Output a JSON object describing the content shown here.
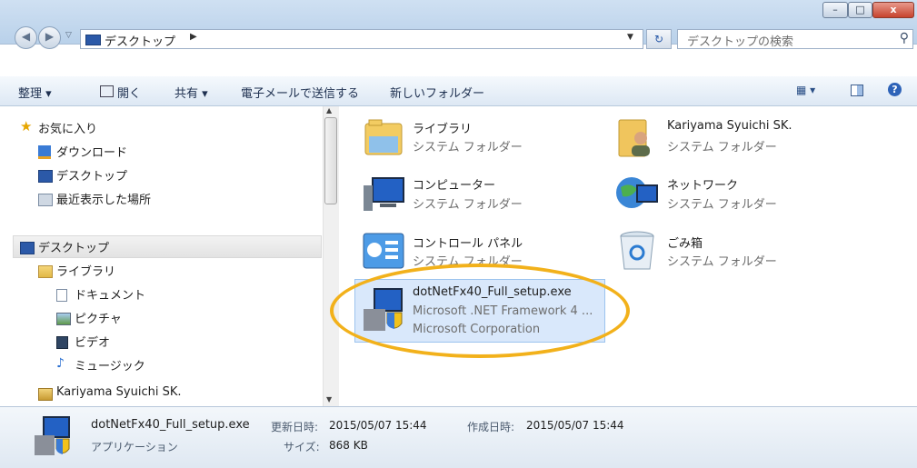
{
  "address": {
    "location": "デスクトップ",
    "search_placeholder": "デスクトップの検索"
  },
  "window": {
    "minimize": "–",
    "maximize": "□",
    "close": "x"
  },
  "toolbar": {
    "organize": "整理 ▾",
    "open": "開く",
    "share": "共有 ▾",
    "email": "電子メールで送信する",
    "new_folder": "新しいフォルダー"
  },
  "nav": {
    "favorites": "お気に入り",
    "downloads": "ダウンロード",
    "desktop_fav": "デスクトップ",
    "recent": "最近表示した場所",
    "desktop": "デスクトップ",
    "libraries": "ライブラリ",
    "documents": "ドキュメント",
    "pictures": "ピクチャ",
    "videos": "ビデオ",
    "music": "ミュージック",
    "user": "Kariyama Syuichi SK."
  },
  "items": [
    {
      "name": "ライブラリ",
      "sub": "システム フォルダー",
      "icon": "library-folder-icon"
    },
    {
      "name": "Kariyama Syuichi SK.",
      "sub": "システム フォルダー",
      "icon": "user-folder-icon"
    },
    {
      "name": "コンピューター",
      "sub": "システム フォルダー",
      "icon": "computer-icon"
    },
    {
      "name": "ネットワーク",
      "sub": "システム フォルダー",
      "icon": "network-icon"
    },
    {
      "name": "コントロール パネル",
      "sub": "システム フォルダー",
      "icon": "control-panel-icon"
    },
    {
      "name": "ごみ箱",
      "sub": "システム フォルダー",
      "icon": "recycle-bin-icon"
    }
  ],
  "selected_file": {
    "name": "dotNetFx40_Full_setup.exe",
    "description": "Microsoft .NET Framework 4 ...",
    "company": "Microsoft Corporation"
  },
  "details": {
    "filename": "dotNetFx40_Full_setup.exe",
    "modified_label": "更新日時:",
    "modified_value": "2015/05/07 15:44",
    "created_label": "作成日時:",
    "created_value": "2015/05/07 15:44",
    "type": "アプリケーション",
    "size_label": "サイズ:",
    "size_value": "868 KB"
  },
  "colors": {
    "highlight": "#f2b11b",
    "selection": "#d9e8fb"
  }
}
